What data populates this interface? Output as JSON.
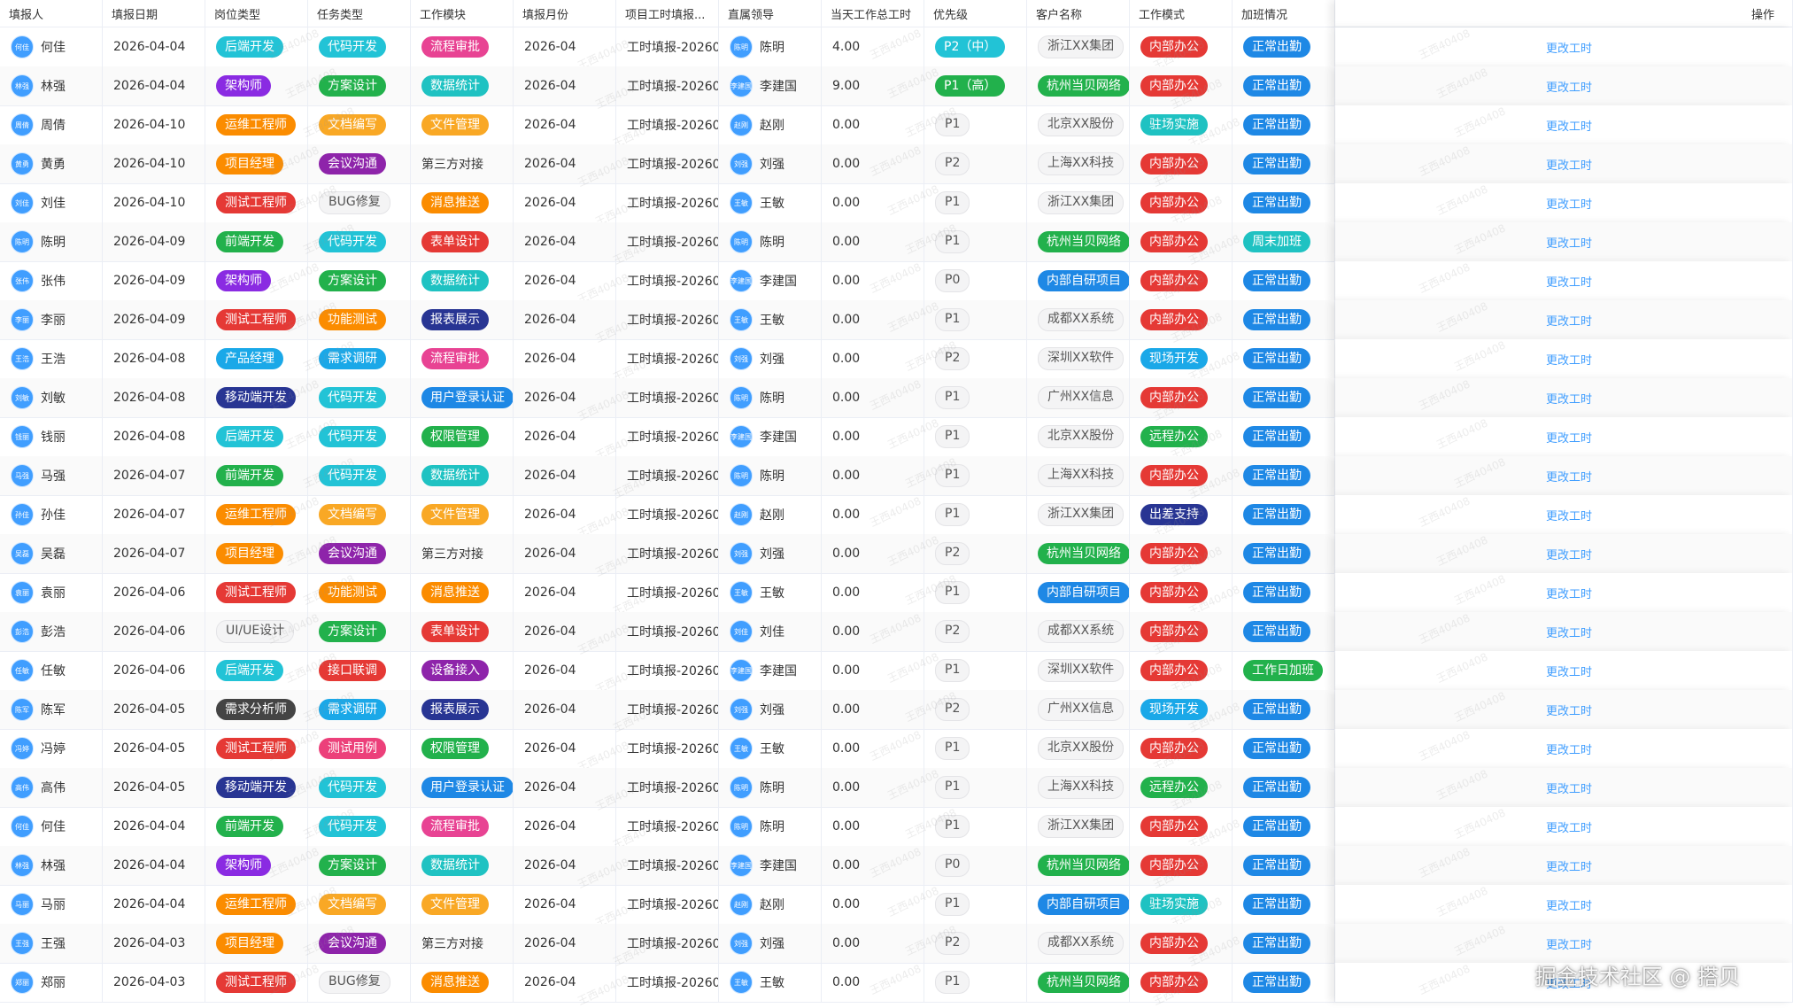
{
  "columns": [
    "填报人",
    "填报日期",
    "岗位类型",
    "任务类型",
    "工作模块",
    "填报月份",
    "项目工时填报...",
    "直属领导",
    "当天工作总工时",
    "优先级",
    "客户名称",
    "工作模式",
    "加班情况",
    "操作"
  ],
  "watermark": "王西40408",
  "brand_watermark": "掘金技术社区 @ 搭贝",
  "rows": [
    {
      "reporter": "何佳",
      "date": "2026-04-04",
      "role": "后端开发",
      "task": "代码开发",
      "module": "流程审批",
      "month": "2026-04",
      "project": "工时填报-2026040...",
      "leader": "陈明",
      "hours": "4.00",
      "priority": "P2（中）",
      "client": "浙江XX集团",
      "mode": "内部办公",
      "overtime": "正常出勤",
      "action": "更改工时"
    },
    {
      "reporter": "林强",
      "date": "2026-04-04",
      "role": "架构师",
      "task": "方案设计",
      "module": "数据统计",
      "month": "2026-04",
      "project": "工时填报-2026040...",
      "leader": "李建国",
      "hours": "9.00",
      "priority": "P1（高）",
      "client": "杭州当贝网络",
      "mode": "内部办公",
      "overtime": "正常出勤",
      "action": "更改工时"
    },
    {
      "reporter": "周倩",
      "date": "2026-04-10",
      "role": "运维工程师",
      "task": "文档编写",
      "module": "文件管理",
      "month": "2026-04",
      "project": "工时填报-2026040...",
      "leader": "赵刚",
      "hours": "0.00",
      "priority": "P1",
      "client": "北京XX股份",
      "mode": "驻场实施",
      "overtime": "正常出勤",
      "action": "更改工时"
    },
    {
      "reporter": "黄勇",
      "date": "2026-04-10",
      "role": "项目经理",
      "task": "会议沟通",
      "module": "第三方对接",
      "month": "2026-04",
      "project": "工时填报-2026040...",
      "leader": "刘强",
      "hours": "0.00",
      "priority": "P2",
      "client": "上海XX科技",
      "mode": "内部办公",
      "overtime": "正常出勤",
      "action": "更改工时"
    },
    {
      "reporter": "刘佳",
      "date": "2026-04-10",
      "role": "测试工程师",
      "task": "BUG修复",
      "module": "消息推送",
      "month": "2026-04",
      "project": "工时填报-2026040...",
      "leader": "王敏",
      "hours": "0.00",
      "priority": "P1",
      "client": "浙江XX集团",
      "mode": "内部办公",
      "overtime": "正常出勤",
      "action": "更改工时"
    },
    {
      "reporter": "陈明",
      "date": "2026-04-09",
      "role": "前端开发",
      "task": "代码开发",
      "module": "表单设计",
      "month": "2026-04",
      "project": "工时填报-2026040...",
      "leader": "陈明",
      "hours": "0.00",
      "priority": "P1",
      "client": "杭州当贝网络",
      "mode": "内部办公",
      "overtime": "周末加班",
      "action": "更改工时"
    },
    {
      "reporter": "张伟",
      "date": "2026-04-09",
      "role": "架构师",
      "task": "方案设计",
      "module": "数据统计",
      "month": "2026-04",
      "project": "工时填报-2026040...",
      "leader": "李建国",
      "hours": "0.00",
      "priority": "P0",
      "client": "内部自研项目",
      "mode": "内部办公",
      "overtime": "正常出勤",
      "action": "更改工时"
    },
    {
      "reporter": "李丽",
      "date": "2026-04-09",
      "role": "测试工程师",
      "task": "功能测试",
      "module": "报表展示",
      "month": "2026-04",
      "project": "工时填报-2026040...",
      "leader": "王敏",
      "hours": "0.00",
      "priority": "P1",
      "client": "成都XX系统",
      "mode": "内部办公",
      "overtime": "正常出勤",
      "action": "更改工时"
    },
    {
      "reporter": "王浩",
      "date": "2026-04-08",
      "role": "产品经理",
      "task": "需求调研",
      "module": "流程审批",
      "month": "2026-04",
      "project": "工时填报-2026040...",
      "leader": "刘强",
      "hours": "0.00",
      "priority": "P2",
      "client": "深圳XX软件",
      "mode": "现场开发",
      "overtime": "正常出勤",
      "action": "更改工时"
    },
    {
      "reporter": "刘敏",
      "date": "2026-04-08",
      "role": "移动端开发",
      "task": "代码开发",
      "module": "用户登录认证",
      "month": "2026-04",
      "project": "工时填报-2026040...",
      "leader": "陈明",
      "hours": "0.00",
      "priority": "P1",
      "client": "广州XX信息",
      "mode": "内部办公",
      "overtime": "正常出勤",
      "action": "更改工时"
    },
    {
      "reporter": "钱丽",
      "date": "2026-04-08",
      "role": "后端开发",
      "task": "代码开发",
      "module": "权限管理",
      "month": "2026-04",
      "project": "工时填报-2026040...",
      "leader": "李建国",
      "hours": "0.00",
      "priority": "P1",
      "client": "北京XX股份",
      "mode": "远程办公",
      "overtime": "正常出勤",
      "action": "更改工时"
    },
    {
      "reporter": "马强",
      "date": "2026-04-07",
      "role": "前端开发",
      "task": "代码开发",
      "module": "数据统计",
      "month": "2026-04",
      "project": "工时填报-2026040...",
      "leader": "陈明",
      "hours": "0.00",
      "priority": "P1",
      "client": "上海XX科技",
      "mode": "内部办公",
      "overtime": "正常出勤",
      "action": "更改工时"
    },
    {
      "reporter": "孙佳",
      "date": "2026-04-07",
      "role": "运维工程师",
      "task": "文档编写",
      "module": "文件管理",
      "month": "2026-04",
      "project": "工时填报-2026040...",
      "leader": "赵刚",
      "hours": "0.00",
      "priority": "P1",
      "client": "浙江XX集团",
      "mode": "出差支持",
      "overtime": "正常出勤",
      "action": "更改工时"
    },
    {
      "reporter": "吴磊",
      "date": "2026-04-07",
      "role": "项目经理",
      "task": "会议沟通",
      "module": "第三方对接",
      "month": "2026-04",
      "project": "工时填报-2026040...",
      "leader": "刘强",
      "hours": "0.00",
      "priority": "P2",
      "client": "杭州当贝网络",
      "mode": "内部办公",
      "overtime": "正常出勤",
      "action": "更改工时"
    },
    {
      "reporter": "袁丽",
      "date": "2026-04-06",
      "role": "测试工程师",
      "task": "功能测试",
      "module": "消息推送",
      "month": "2026-04",
      "project": "工时填报-2026040...",
      "leader": "王敏",
      "hours": "0.00",
      "priority": "P1",
      "client": "内部自研项目",
      "mode": "内部办公",
      "overtime": "正常出勤",
      "action": "更改工时"
    },
    {
      "reporter": "彭浩",
      "date": "2026-04-06",
      "role": "UI/UE设计",
      "task": "方案设计",
      "module": "表单设计",
      "month": "2026-04",
      "project": "工时填报-2026040...",
      "leader": "刘佳",
      "hours": "0.00",
      "priority": "P2",
      "client": "成都XX系统",
      "mode": "内部办公",
      "overtime": "正常出勤",
      "action": "更改工时"
    },
    {
      "reporter": "任敏",
      "date": "2026-04-06",
      "role": "后端开发",
      "task": "接口联调",
      "module": "设备接入",
      "month": "2026-04",
      "project": "工时填报-2026040...",
      "leader": "李建国",
      "hours": "0.00",
      "priority": "P1",
      "client": "深圳XX软件",
      "mode": "内部办公",
      "overtime": "工作日加班",
      "action": "更改工时"
    },
    {
      "reporter": "陈军",
      "date": "2026-04-05",
      "role": "需求分析师",
      "task": "需求调研",
      "module": "报表展示",
      "month": "2026-04",
      "project": "工时填报-2026040...",
      "leader": "刘强",
      "hours": "0.00",
      "priority": "P2",
      "client": "广州XX信息",
      "mode": "现场开发",
      "overtime": "正常出勤",
      "action": "更改工时"
    },
    {
      "reporter": "冯婷",
      "date": "2026-04-05",
      "role": "测试工程师",
      "task": "测试用例",
      "module": "权限管理",
      "month": "2026-04",
      "project": "工时填报-2026040...",
      "leader": "王敏",
      "hours": "0.00",
      "priority": "P1",
      "client": "北京XX股份",
      "mode": "内部办公",
      "overtime": "正常出勤",
      "action": "更改工时"
    },
    {
      "reporter": "高伟",
      "date": "2026-04-05",
      "role": "移动端开发",
      "task": "代码开发",
      "module": "用户登录认证",
      "month": "2026-04",
      "project": "工时填报-2026040...",
      "leader": "陈明",
      "hours": "0.00",
      "priority": "P1",
      "client": "上海XX科技",
      "mode": "远程办公",
      "overtime": "正常出勤",
      "action": "更改工时"
    },
    {
      "reporter": "何佳",
      "date": "2026-04-04",
      "role": "前端开发",
      "task": "代码开发",
      "module": "流程审批",
      "month": "2026-04",
      "project": "工时填报-2026040...",
      "leader": "陈明",
      "hours": "0.00",
      "priority": "P1",
      "client": "浙江XX集团",
      "mode": "内部办公",
      "overtime": "正常出勤",
      "action": "更改工时"
    },
    {
      "reporter": "林强",
      "date": "2026-04-04",
      "role": "架构师",
      "task": "方案设计",
      "module": "数据统计",
      "month": "2026-04",
      "project": "工时填报-2026040...",
      "leader": "李建国",
      "hours": "0.00",
      "priority": "P0",
      "client": "杭州当贝网络",
      "mode": "内部办公",
      "overtime": "正常出勤",
      "action": "更改工时"
    },
    {
      "reporter": "马丽",
      "date": "2026-04-04",
      "role": "运维工程师",
      "task": "文档编写",
      "module": "文件管理",
      "month": "2026-04",
      "project": "工时填报-2026040...",
      "leader": "赵刚",
      "hours": "0.00",
      "priority": "P1",
      "client": "内部自研项目",
      "mode": "驻场实施",
      "overtime": "正常出勤",
      "action": "更改工时"
    },
    {
      "reporter": "王强",
      "date": "2026-04-03",
      "role": "项目经理",
      "task": "会议沟通",
      "module": "第三方对接",
      "month": "2026-04",
      "project": "工时填报-2026040...",
      "leader": "刘强",
      "hours": "0.00",
      "priority": "P2",
      "client": "成都XX系统",
      "mode": "内部办公",
      "overtime": "正常出勤",
      "action": "更改工时"
    },
    {
      "reporter": "郑丽",
      "date": "2026-04-03",
      "role": "测试工程师",
      "task": "BUG修复",
      "module": "消息推送",
      "month": "2026-04",
      "project": "工时填报-2026040...",
      "leader": "王敏",
      "hours": "0.00",
      "priority": "P1",
      "client": "杭州当贝网络",
      "mode": "内部办公",
      "overtime": "正常出勤",
      "action": "更改工时"
    }
  ],
  "colors": {
    "role": {
      "后端开发": "#22c3d6",
      "架构师": "#8a2be2",
      "运维工程师": "#fb8c00",
      "项目经理": "#fb8c00",
      "测试工程师": "#e53935",
      "前端开发": "#22b14c",
      "产品经理": "#1aa8e8",
      "移动端开发": "#283593",
      "UI/UE设计": "plain",
      "需求分析师": "#444444"
    },
    "task": {
      "代码开发": "#22c3d6",
      "方案设计": "#22b14c",
      "文档编写": "#f9a825",
      "会议沟通": "#8e24aa",
      "BUG修复": "plain",
      "功能测试": "#fb8c00",
      "需求调研": "#1aa8e8",
      "接口联调": "#e53935",
      "测试用例": "#ec407a"
    },
    "module": {
      "流程审批": "#e84393",
      "数据统计": "#1fc2c2",
      "文件管理": "#f9a825",
      "第三方对接": "none",
      "消息推送": "#fb8c00",
      "表单设计": "#e53935",
      "报表展示": "#283593",
      "用户登录认证": "#1e88e5",
      "权限管理": "#22b14c",
      "设备接入": "#8e24aa"
    },
    "priority": {
      "P2（中）": "#22c3d6",
      "P1（高）": "#22b14c"
    },
    "client": {
      "杭州当贝网络": "#22b14c",
      "内部自研项目": "#1e88e5"
    },
    "mode": {
      "内部办公": "#e53935",
      "驻场实施": "#1fc2c2",
      "现场开发": "#1aa8e8",
      "远程办公": "#22b14c",
      "出差支持": "#283593"
    },
    "overtime": {
      "正常出勤": "#1e88e5",
      "周末加班": "#1fc2c2",
      "工作日加班": "#22b14c"
    }
  }
}
